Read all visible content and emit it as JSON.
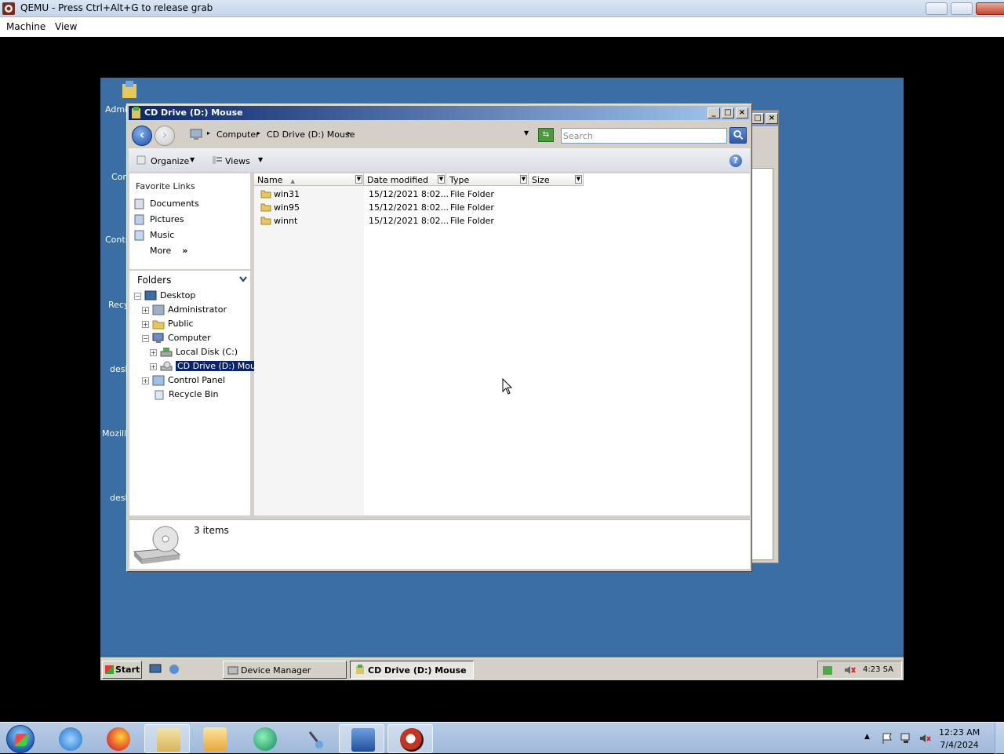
{
  "host": {
    "title": "QEMU - Press Ctrl+Alt+G to release grab",
    "menu": [
      "Machine",
      "View"
    ]
  },
  "desktop_icons": [
    "Admi",
    "Con",
    "Contr",
    "Recy",
    "desk",
    "Mozilla",
    "desk"
  ],
  "explorer": {
    "title": "CD Drive (D:) Mouse",
    "breadcrumb": [
      "Computer",
      "CD Drive (D:) Mouse"
    ],
    "search_placeholder": "Search",
    "toolbar": {
      "organize": "Organize",
      "views": "Views"
    },
    "favorite_links_title": "Favorite Links",
    "favorite_links": [
      "Documents",
      "Pictures",
      "Music",
      "More"
    ],
    "folders_title": "Folders",
    "tree": [
      {
        "label": "Desktop",
        "expander": "−"
      },
      {
        "label": "Administrator",
        "expander": "+"
      },
      {
        "label": "Public",
        "expander": "+"
      },
      {
        "label": "Computer",
        "expander": "−"
      },
      {
        "label": "Local Disk (C:)",
        "expander": "+"
      },
      {
        "label": "CD Drive (D:) Mouse",
        "expander": "+"
      },
      {
        "label": "Control Panel",
        "expander": "+"
      },
      {
        "label": "Recycle Bin",
        "expander": ""
      }
    ],
    "columns": [
      "Name",
      "Date modified",
      "Type",
      "Size"
    ],
    "files": [
      {
        "name": "win31",
        "date": "15/12/2021 8:02...",
        "type": "File Folder",
        "size": ""
      },
      {
        "name": "win95",
        "date": "15/12/2021 8:02...",
        "type": "File Folder",
        "size": ""
      },
      {
        "name": "winnt",
        "date": "15/12/2021 8:02...",
        "type": "File Folder",
        "size": ""
      }
    ],
    "item_count": "3 items"
  },
  "guest_taskbar": {
    "start": "Start",
    "tasks": [
      "Device Manager",
      "CD Drive (D:) Mouse"
    ],
    "clock": "4:23 SA"
  },
  "host_taskbar": {
    "apps": [
      "start-orb",
      "internet-explorer",
      "firefox",
      "file-explorer",
      "media-player",
      "app-green",
      "tools",
      "powershell",
      "qemu"
    ],
    "time": "12:23 AM",
    "date": "7/4/2024"
  },
  "colors": {
    "guest_desktop": "#3a6ea5",
    "classic_face": "#d4d0c8",
    "title_active": "#0a246a",
    "selection": "#0a246a"
  }
}
